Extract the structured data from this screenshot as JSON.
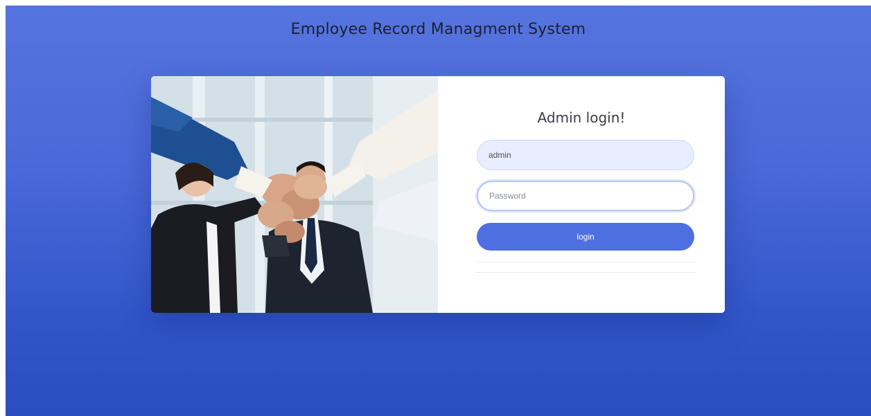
{
  "header": {
    "title": "Employee Record Managment System"
  },
  "login": {
    "heading": "Admin login!",
    "username_value": "admin",
    "password_placeholder": "Password",
    "submit_label": "login"
  },
  "colors": {
    "background_top": "#5574de",
    "background_bottom": "#2a4ec2",
    "button": "#4e6fdf",
    "username_field": "#e8eeff"
  },
  "photo": {
    "subject": "team-fist-bump-photo"
  }
}
